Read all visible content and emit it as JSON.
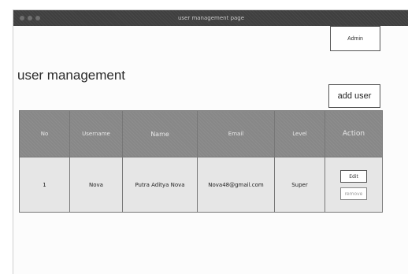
{
  "window": {
    "title": "user management page"
  },
  "header": {
    "admin_label": "Admin"
  },
  "page": {
    "title": "user management",
    "add_user_label": "add user"
  },
  "table": {
    "columns": [
      "No",
      "Username",
      "Name",
      "Email",
      "Level",
      "Action"
    ],
    "rows": [
      {
        "no": "1",
        "username": "Nova",
        "name": "Putra Aditya Nova",
        "email": "Nova48@gmail.com",
        "level": "Super",
        "edit_label": "Edit",
        "remove_label": "remove"
      }
    ]
  },
  "colors": {
    "titlebar": "#3f3f3f",
    "table_header": "#878787",
    "table_row": "#e6e6e6"
  }
}
